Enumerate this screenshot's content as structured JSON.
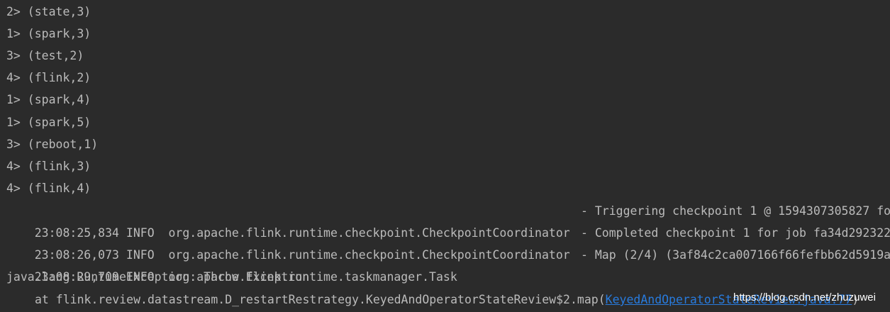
{
  "console": {
    "output_lines": [
      "2> (state,3)",
      "1> (spark,3)",
      "3> (test,2)",
      "4> (flink,2)",
      "1> (spark,4)",
      "1> (spark,5)",
      "3> (reboot,1)",
      "4> (flink,3)",
      "4> (flink,4)"
    ],
    "log_lines": [
      {
        "prefix": "23:08:25,834 INFO  org.apache.flink.runtime.checkpoint.CheckpointCoordinator",
        "message": "- Triggering checkpoint 1 @ 1594307305827 fo"
      },
      {
        "prefix": "23:08:26,073 INFO  org.apache.flink.runtime.checkpoint.CheckpointCoordinator",
        "message": "- Completed checkpoint 1 for job fa34d292322"
      },
      {
        "prefix": "23:08:29,709 INFO  org.apache.flink.runtime.taskmanager.Task",
        "message": "- Map (2/4) (3af84c2ca007166f66fefbb62d5919a"
      }
    ],
    "exception_line": "java.lang.RuntimeException: Throw Exception",
    "stack_line": {
      "text": "at flink.review.datastream.D_restartRestrategy.KeyedAndOperatorStateReview$2.map(",
      "link": "KeyedAndOperatorStateReview.java:77",
      "close": ")"
    },
    "watermark": "https://blog.csdn.net/zhuzuwei"
  }
}
